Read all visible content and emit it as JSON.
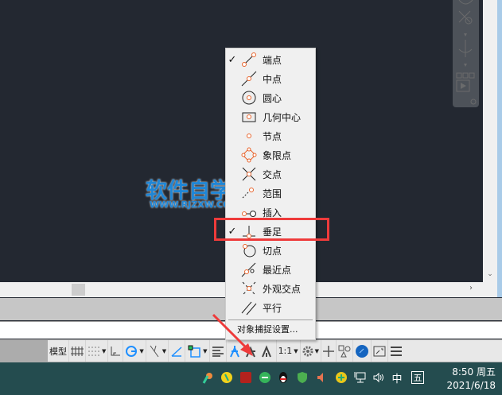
{
  "snap_menu": {
    "items": [
      {
        "label": "端点",
        "checked": true,
        "icon": "endpoint-snap-icon"
      },
      {
        "label": "中点",
        "checked": false,
        "icon": "midpoint-snap-icon"
      },
      {
        "label": "圆心",
        "checked": false,
        "icon": "center-snap-icon"
      },
      {
        "label": "几何中心",
        "checked": false,
        "icon": "geometric-center-snap-icon"
      },
      {
        "label": "节点",
        "checked": false,
        "icon": "node-snap-icon"
      },
      {
        "label": "象限点",
        "checked": false,
        "icon": "quadrant-snap-icon"
      },
      {
        "label": "交点",
        "checked": false,
        "icon": "intersection-snap-icon"
      },
      {
        "label": "范围",
        "checked": false,
        "icon": "extension-snap-icon"
      },
      {
        "label": "插入",
        "checked": false,
        "icon": "insertion-snap-icon"
      },
      {
        "label": "垂足",
        "checked": true,
        "icon": "perpendicular-snap-icon"
      },
      {
        "label": "切点",
        "checked": false,
        "icon": "tangent-snap-icon"
      },
      {
        "label": "最近点",
        "checked": false,
        "icon": "nearest-snap-icon"
      },
      {
        "label": "外观交点",
        "checked": false,
        "icon": "apparent-intersection-snap-icon"
      },
      {
        "label": "平行",
        "checked": false,
        "icon": "parallel-snap-icon"
      }
    ],
    "settings_label": "对象捕捉设置...",
    "check_mark": "✓"
  },
  "watermark": {
    "title": "软件自学网",
    "url": "WWW.RJZXW.COM"
  },
  "statusbar": {
    "model_label": "模型",
    "scale_label": "1:1",
    "caret": "▼"
  },
  "taskbar": {
    "time": "8:50 周五",
    "date": "2021/6/18",
    "ime_lang": "中",
    "ime_mode": "五"
  },
  "colors": {
    "accent": "#1e8fff",
    "snap_marker": "#e8632b",
    "highlight": "#ee3b3b"
  }
}
